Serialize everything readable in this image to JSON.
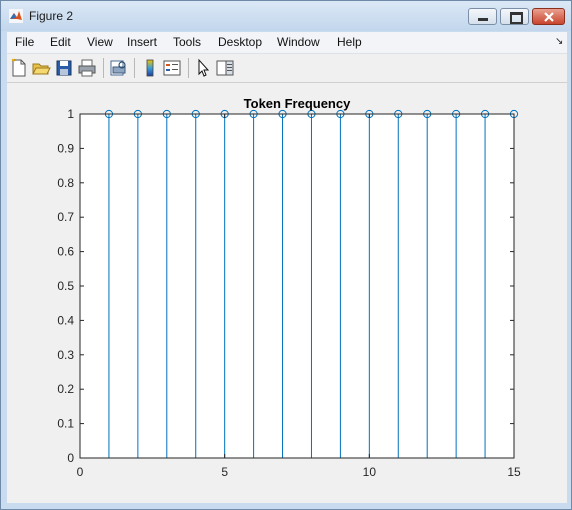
{
  "window": {
    "title": "Figure 2"
  },
  "menu": [
    "File",
    "Edit",
    "View",
    "Insert",
    "Tools",
    "Desktop",
    "Window",
    "Help"
  ],
  "toolbar": [
    "new-figure-icon",
    "open-file-icon",
    "save-icon",
    "print-icon",
    "print-preview-icon",
    "insert-colorbar-icon",
    "insert-legend-icon",
    "edit-plot-arrow-icon",
    "show-plot-tools-icon"
  ],
  "colors": {
    "stem": "#0072bd",
    "figure_bg": "#f0f0f0",
    "axes_bg": "#ffffff"
  },
  "chart_data": {
    "type": "stem",
    "title": "Token Frequency",
    "x": [
      1,
      2,
      3,
      4,
      5,
      6,
      7,
      8,
      9,
      10,
      11,
      12,
      13,
      14,
      15
    ],
    "values": [
      1,
      1,
      1,
      1,
      1,
      1,
      1,
      1,
      1,
      1,
      1,
      1,
      1,
      1,
      1
    ],
    "xlim": [
      0,
      15
    ],
    "ylim": [
      0,
      1
    ],
    "xticks": [
      "0",
      "5",
      "10",
      "15"
    ],
    "yticks": [
      "0",
      "0.1",
      "0.2",
      "0.3",
      "0.4",
      "0.5",
      "0.6",
      "0.7",
      "0.8",
      "0.9",
      "1"
    ],
    "grid": false,
    "marker": "circle"
  }
}
